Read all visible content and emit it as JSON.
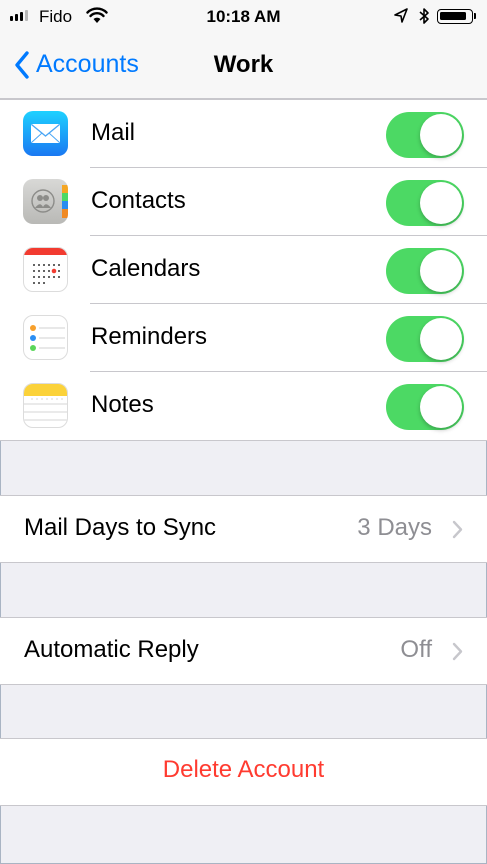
{
  "status_bar": {
    "carrier": "Fido",
    "time": "10:18 AM",
    "signal_bars_filled": 3,
    "battery_level": 0.9,
    "icons": [
      "signal-icon",
      "wifi-icon",
      "location-arrow-icon",
      "bluetooth-icon",
      "battery-icon"
    ]
  },
  "nav": {
    "back_label": "Accounts",
    "title": "Work"
  },
  "sync_items": [
    {
      "label": "Mail",
      "icon": "mail-app-icon",
      "enabled": true
    },
    {
      "label": "Contacts",
      "icon": "contacts-app-icon",
      "enabled": true
    },
    {
      "label": "Calendars",
      "icon": "calendar-app-icon",
      "enabled": true
    },
    {
      "label": "Reminders",
      "icon": "reminders-app-icon",
      "enabled": true
    },
    {
      "label": "Notes",
      "icon": "notes-app-icon",
      "enabled": true
    }
  ],
  "mail_days": {
    "label": "Mail Days to Sync",
    "value": "3 Days"
  },
  "auto_reply": {
    "label": "Automatic Reply",
    "value": "Off"
  },
  "delete_label": "Delete Account",
  "colors": {
    "accent": "#007aff",
    "switch_on": "#4cd964",
    "destructive": "#ff3b30",
    "secondary_text": "#8e8e93",
    "background": "#efeff4"
  }
}
